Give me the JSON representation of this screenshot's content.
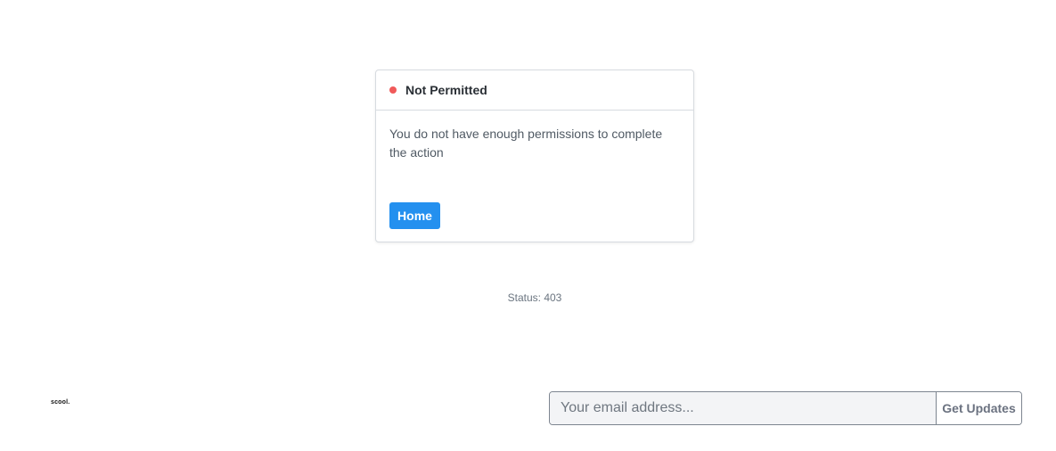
{
  "card": {
    "title": "Not Permitted",
    "status_color": "#f05a5a",
    "message": "You do not have enough permissions to complete the action",
    "home_button_label": "Home",
    "button_color": "#2490ef"
  },
  "status": {
    "text": "Status: 403"
  },
  "footer": {
    "logo_text": "scool.",
    "email_placeholder": "Your email address...",
    "email_value": "",
    "updates_button_label": "Get Updates"
  }
}
